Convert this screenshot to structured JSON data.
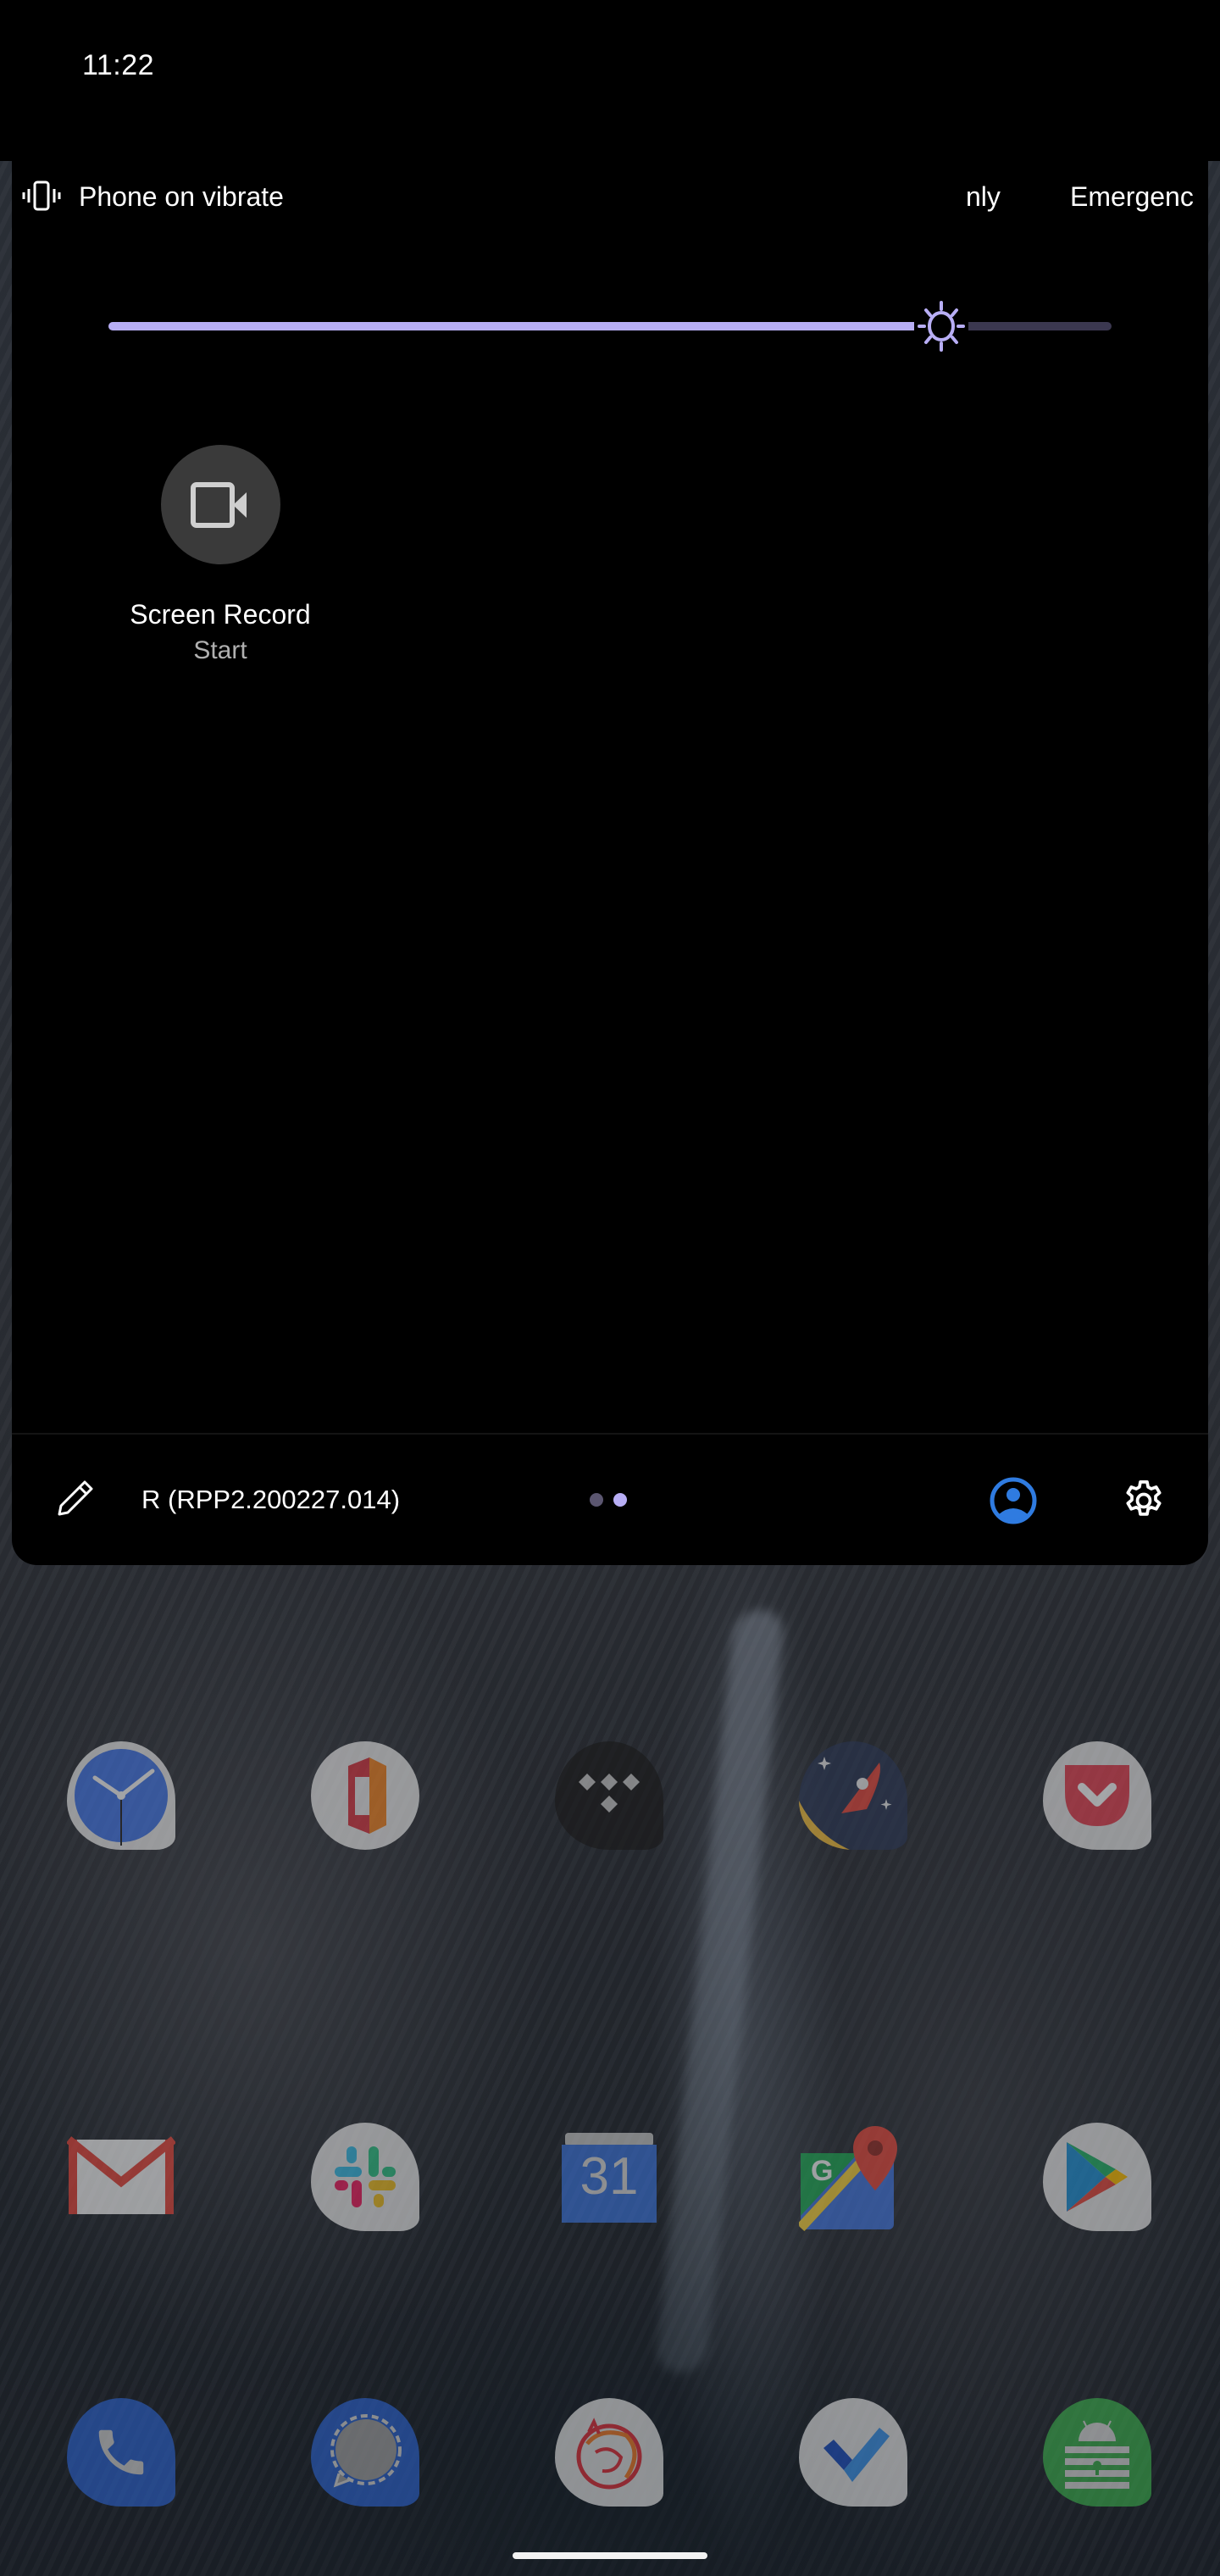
{
  "status_bar": {
    "time": "11:22"
  },
  "quick_settings": {
    "ringer_status": {
      "icon": "vibrate-icon",
      "label": "Phone on vibrate"
    },
    "carrier_text_truncated": "nly",
    "emergency_text_truncated": "Emergenc",
    "brightness": {
      "icon": "brightness-sun-icon",
      "level_percent": 83,
      "fill_color": "#b8aef5",
      "track_color": "#3b3850"
    },
    "tiles": [
      {
        "name": "Screen Record",
        "state": "Start",
        "icon": "videocam-icon",
        "active": false
      }
    ],
    "footer": {
      "edit_icon": "pencil-icon",
      "build_number": "R (RPP2.200227.014)",
      "pages": {
        "count": 2,
        "current": 2
      },
      "user_icon": "account-circle-icon",
      "user_icon_color": "#2f7be0",
      "settings_icon": "gear-icon"
    }
  },
  "home_screen": {
    "rows": [
      [
        {
          "app": "Clock",
          "icon": "clock-icon"
        },
        {
          "app": "Office",
          "icon": "office-icon"
        },
        {
          "app": "TIDAL",
          "icon": "tidal-icon"
        },
        {
          "app": "Rocket",
          "icon": "rocket-icon"
        },
        {
          "app": "Pocket",
          "icon": "pocket-icon"
        }
      ],
      [
        {
          "app": "Gmail",
          "icon": "gmail-icon"
        },
        {
          "app": "Slack",
          "icon": "slack-icon"
        },
        {
          "app": "Calendar",
          "icon": "calendar-icon",
          "badge_text": "31"
        },
        {
          "app": "Maps",
          "icon": "maps-icon",
          "badge_text": "G"
        },
        {
          "app": "Play Store",
          "icon": "play-store-icon"
        }
      ]
    ],
    "dock": [
      {
        "app": "Phone",
        "icon": "phone-icon"
      },
      {
        "app": "Signal",
        "icon": "signal-icon"
      },
      {
        "app": "Firefox",
        "icon": "firefox-icon"
      },
      {
        "app": "Tasks",
        "icon": "tasks-check-icon"
      },
      {
        "app": "KeePass",
        "icon": "keepass-icon"
      }
    ]
  }
}
